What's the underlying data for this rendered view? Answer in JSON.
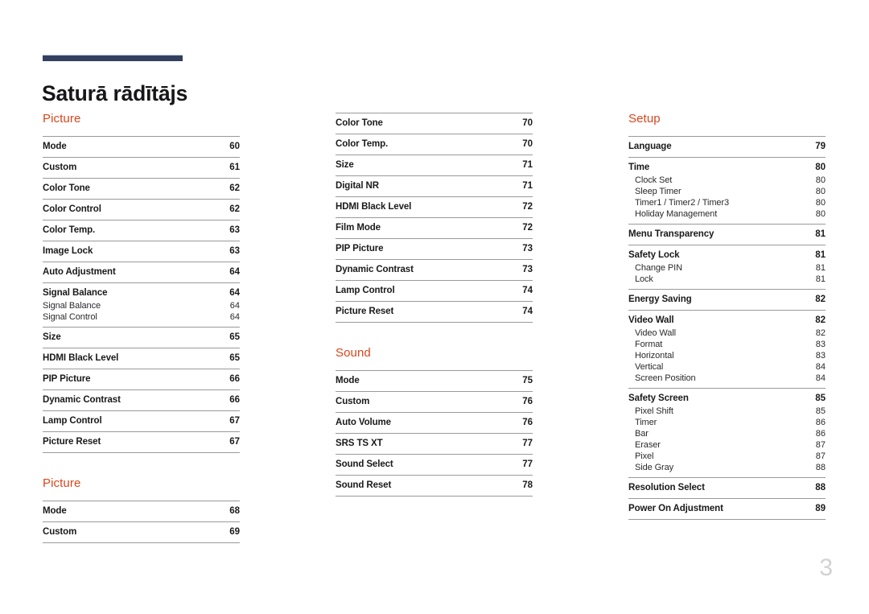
{
  "document": {
    "title": "Saturā rādītājs",
    "folio": "3",
    "accent_color": "#d9451c",
    "rule_color": "#333f5e"
  },
  "columns": [
    {
      "id": "column-1",
      "sections": [
        {
          "title": "Picture",
          "entries": [
            {
              "label": "Mode",
              "page": "60",
              "level": "main"
            },
            {
              "label": "Custom",
              "page": "61",
              "level": "main"
            },
            {
              "label": "Color Tone",
              "page": "62",
              "level": "main"
            },
            {
              "label": "Color Control",
              "page": "62",
              "level": "main"
            },
            {
              "label": "Color Temp.",
              "page": "63",
              "level": "main"
            },
            {
              "label": "Image Lock",
              "page": "63",
              "level": "main"
            },
            {
              "label": "Auto Adjustment",
              "page": "64",
              "level": "main"
            },
            {
              "label": "Signal Balance",
              "page": "64",
              "level": "main"
            },
            {
              "label": "Signal Balance",
              "page": "64",
              "level": "sub"
            },
            {
              "label": "Signal Control",
              "page": "64",
              "level": "sub"
            },
            {
              "label": "Size",
              "page": "65",
              "level": "main"
            },
            {
              "label": "HDMI Black Level",
              "page": "65",
              "level": "main"
            },
            {
              "label": "PIP Picture",
              "page": "66",
              "level": "main"
            },
            {
              "label": "Dynamic Contrast",
              "page": "66",
              "level": "main"
            },
            {
              "label": "Lamp Control",
              "page": "67",
              "level": "main"
            },
            {
              "label": "Picture Reset",
              "page": "67",
              "level": "main"
            }
          ]
        },
        {
          "title": "Picture",
          "entries": [
            {
              "label": "Mode",
              "page": "68",
              "level": "main"
            },
            {
              "label": "Custom",
              "page": "69",
              "level": "main"
            }
          ]
        }
      ]
    },
    {
      "id": "column-2",
      "sections": [
        {
          "title": "",
          "entries": [
            {
              "label": "Color Tone",
              "page": "70",
              "level": "main"
            },
            {
              "label": "Color Temp.",
              "page": "70",
              "level": "main"
            },
            {
              "label": "Size",
              "page": "71",
              "level": "main"
            },
            {
              "label": "Digital NR",
              "page": "71",
              "level": "main"
            },
            {
              "label": "HDMI Black Level",
              "page": "72",
              "level": "main"
            },
            {
              "label": "Film Mode",
              "page": "72",
              "level": "main"
            },
            {
              "label": "PIP Picture",
              "page": "73",
              "level": "main"
            },
            {
              "label": "Dynamic Contrast",
              "page": "73",
              "level": "main"
            },
            {
              "label": "Lamp Control",
              "page": "74",
              "level": "main"
            },
            {
              "label": "Picture Reset",
              "page": "74",
              "level": "main"
            }
          ]
        },
        {
          "title": "Sound",
          "entries": [
            {
              "label": "Mode",
              "page": "75",
              "level": "main"
            },
            {
              "label": "Custom",
              "page": "76",
              "level": "main"
            },
            {
              "label": "Auto Volume",
              "page": "76",
              "level": "main"
            },
            {
              "label": "SRS TS XT",
              "page": "77",
              "level": "main"
            },
            {
              "label": "Sound Select",
              "page": "77",
              "level": "main"
            },
            {
              "label": "Sound Reset",
              "page": "78",
              "level": "main"
            }
          ]
        }
      ]
    },
    {
      "id": "column-3",
      "sections": [
        {
          "title": "Setup",
          "entries": [
            {
              "label": "Language",
              "page": "79",
              "level": "main"
            },
            {
              "label": "Time",
              "page": "80",
              "level": "main"
            },
            {
              "label": "Clock Set",
              "page": "80",
              "level": "sub"
            },
            {
              "label": "Sleep Timer",
              "page": "80",
              "level": "sub"
            },
            {
              "label": "Timer1 / Timer2 / Timer3",
              "page": "80",
              "level": "sub"
            },
            {
              "label": "Holiday Management",
              "page": "80",
              "level": "sub"
            },
            {
              "label": "Menu Transparency",
              "page": "81",
              "level": "main"
            },
            {
              "label": "Safety Lock",
              "page": "81",
              "level": "main"
            },
            {
              "label": "Change PIN",
              "page": "81",
              "level": "sub"
            },
            {
              "label": "Lock",
              "page": "81",
              "level": "sub"
            },
            {
              "label": "Energy Saving",
              "page": "82",
              "level": "main"
            },
            {
              "label": "Video Wall",
              "page": "82",
              "level": "main"
            },
            {
              "label": "Video Wall",
              "page": "82",
              "level": "sub"
            },
            {
              "label": "Format",
              "page": "83",
              "level": "sub"
            },
            {
              "label": "Horizontal",
              "page": "83",
              "level": "sub"
            },
            {
              "label": "Vertical",
              "page": "84",
              "level": "sub"
            },
            {
              "label": "Screen Position",
              "page": "84",
              "level": "sub"
            },
            {
              "label": "Safety Screen",
              "page": "85",
              "level": "main"
            },
            {
              "label": "Pixel Shift",
              "page": "85",
              "level": "sub"
            },
            {
              "label": "Timer",
              "page": "86",
              "level": "sub"
            },
            {
              "label": "Bar",
              "page": "86",
              "level": "sub"
            },
            {
              "label": "Eraser",
              "page": "87",
              "level": "sub"
            },
            {
              "label": "Pixel",
              "page": "87",
              "level": "sub"
            },
            {
              "label": "Side Gray",
              "page": "88",
              "level": "sub"
            },
            {
              "label": "Resolution Select",
              "page": "88",
              "level": "main"
            },
            {
              "label": "Power On Adjustment",
              "page": "89",
              "level": "main"
            }
          ]
        }
      ]
    }
  ]
}
